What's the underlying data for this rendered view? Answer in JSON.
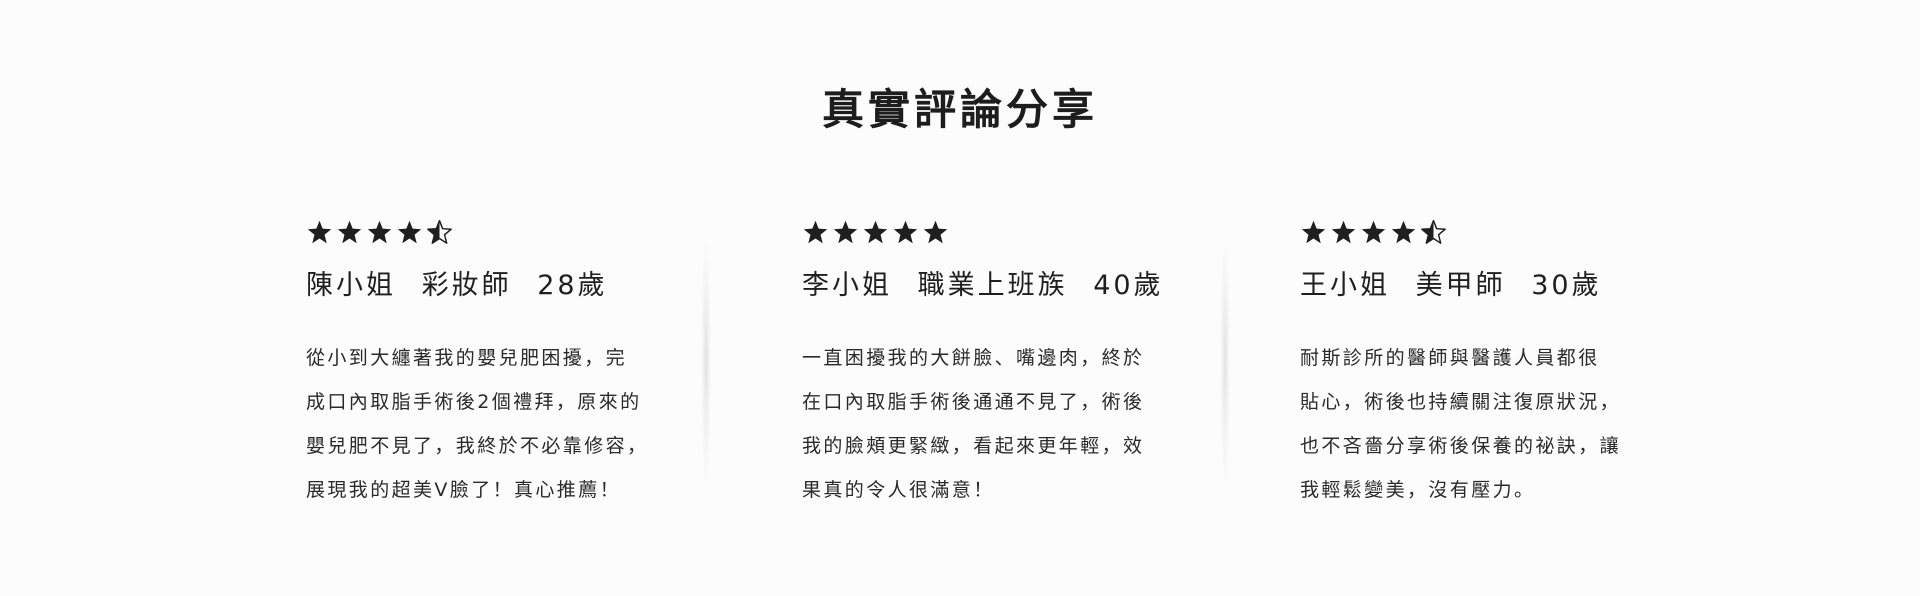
{
  "section": {
    "title": "真實評論分享"
  },
  "colors": {
    "star": "#1f1f1f",
    "text": "#2a2a2a",
    "background": "#fcfcfc"
  },
  "reviews": [
    {
      "rating": 4.5,
      "name": "陳小姐",
      "role": "彩妝師",
      "age": "28歲",
      "lines": [
        "從小到大纏著我的嬰兒肥困擾，完",
        "成口內取脂手術後2個禮拜，原來的",
        "嬰兒肥不見了，我終於不必靠修容，",
        "展現我的超美V臉了！真心推薦！"
      ]
    },
    {
      "rating": 5,
      "name": "李小姐",
      "role": "職業上班族",
      "age": "40歲",
      "lines": [
        "一直困擾我的大餅臉、嘴邊肉，終於",
        "在口內取脂手術後通通不見了，術後",
        "我的臉頰更緊緻，看起來更年輕，效",
        "果真的令人很滿意！"
      ]
    },
    {
      "rating": 4.5,
      "name": "王小姐",
      "role": "美甲師",
      "age": "30歲",
      "lines": [
        "耐斯診所的醫師與醫護人員都很",
        "貼心，術後也持續關注復原狀況，",
        "也不吝嗇分享術後保養的祕訣，讓",
        "我輕鬆變美，沒有壓力。"
      ]
    }
  ]
}
